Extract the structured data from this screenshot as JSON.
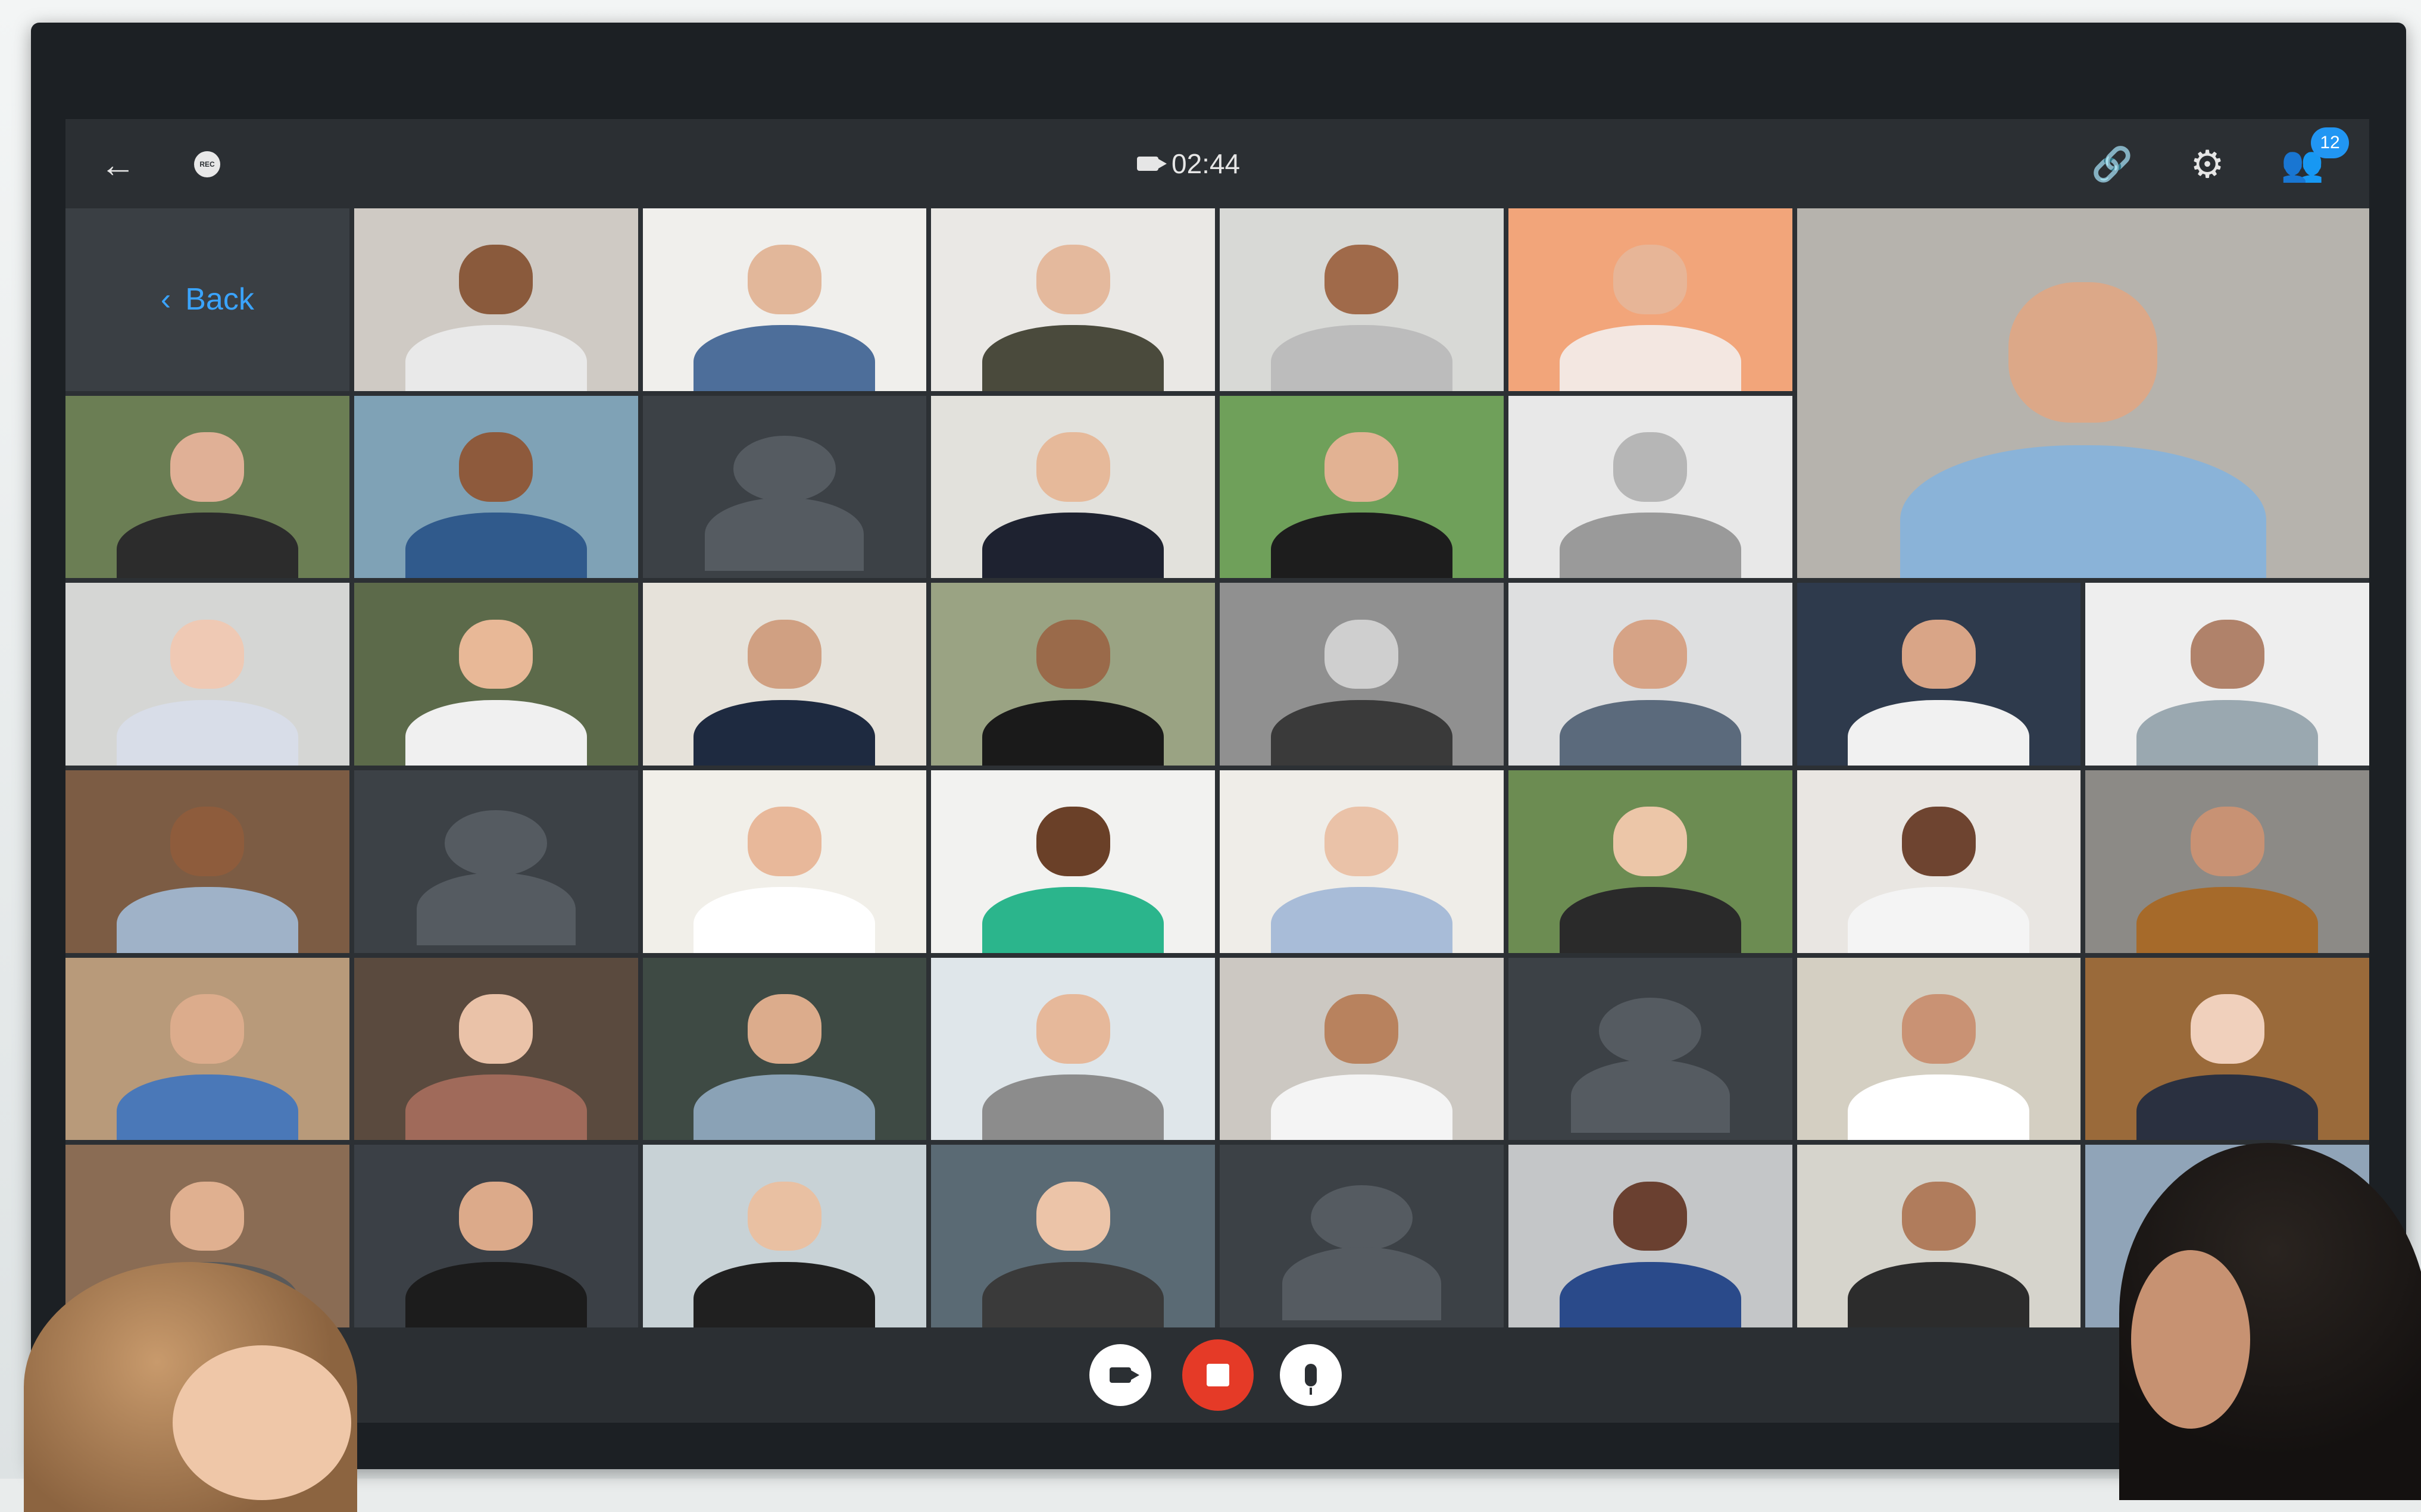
{
  "topbar": {
    "timer": "02:44",
    "rec_label": "REC",
    "participants_count": "12"
  },
  "sidebar": {
    "back_label": "Back"
  },
  "icons": {
    "back": "arrow-left-icon",
    "rec": "rec-icon",
    "timer_camera": "video-camera-icon",
    "link": "link-icon",
    "settings": "gear-icon",
    "participants": "people-icon",
    "video": "video-camera-icon",
    "stop": "stop-icon",
    "mic": "microphone-icon"
  },
  "colors": {
    "accent_blue": "#3aa4ff",
    "badge_blue": "#2196f3",
    "stop_red": "#e53a27",
    "bar_dark": "#2b2f33",
    "empty_tile": "#3c4146"
  },
  "grid": {
    "columns": 8,
    "rows": 6,
    "tiles": [
      {
        "kind": "back"
      },
      {
        "kind": "video",
        "bg": "#cfcac4",
        "skin": "#8a5a3c",
        "cloth": "#e9e9e9"
      },
      {
        "kind": "video",
        "bg": "#f0efec",
        "skin": "#e2b79a",
        "cloth": "#4d6e9a"
      },
      {
        "kind": "video",
        "bg": "#eae8e5",
        "skin": "#e4b99d",
        "cloth": "#4a4a3c"
      },
      {
        "kind": "video",
        "bg": "#d8d9d6",
        "skin": "#a06a4a",
        "cloth": "#bcbcbc"
      },
      {
        "kind": "video",
        "bg": "#f2a57a",
        "skin": "#e7b597",
        "cloth": "#f3e7e1"
      },
      {
        "kind": "featured",
        "bg": "#b6b3ad",
        "skin": "#dca888",
        "cloth": "#8ab3d8"
      },
      {
        "kind": "featured-cont"
      },
      {
        "kind": "video",
        "bg": "#6b7e54",
        "skin": "#e0b096",
        "cloth": "#2c2c2c"
      },
      {
        "kind": "video",
        "bg": "#7fa2b6",
        "skin": "#8e5a3c",
        "cloth": "#305a8c"
      },
      {
        "kind": "empty"
      },
      {
        "kind": "video",
        "bg": "#e2e1dc",
        "skin": "#e6b99a",
        "cloth": "#1e2230"
      },
      {
        "kind": "video",
        "bg": "#6fa05a",
        "skin": "#e2b293",
        "cloth": "#1d1d1d"
      },
      {
        "kind": "video",
        "bg": "#e8e8e8",
        "skin": "#b6b6b6",
        "cloth": "#9a9a9a"
      },
      {
        "kind": "featured-cont"
      },
      {
        "kind": "featured-cont"
      },
      {
        "kind": "video",
        "bg": "#d5d6d4",
        "skin": "#efc9b4",
        "cloth": "#d8dde8"
      },
      {
        "kind": "video",
        "bg": "#5c6a4a",
        "skin": "#e8b897",
        "cloth": "#f0f0f0"
      },
      {
        "kind": "video",
        "bg": "#e6e2da",
        "skin": "#d0a082",
        "cloth": "#1e2a40"
      },
      {
        "kind": "video",
        "bg": "#9aa383",
        "skin": "#9a6a4a",
        "cloth": "#1a1a1a"
      },
      {
        "kind": "video",
        "bg": "#909090",
        "skin": "#cfcfcf",
        "cloth": "#3a3a3a"
      },
      {
        "kind": "video",
        "bg": "#dedfe0",
        "skin": "#d6a386",
        "cloth": "#5b6a7c"
      },
      {
        "kind": "video",
        "bg": "#2e3a4c",
        "skin": "#d9a587",
        "cloth": "#f1f1f1"
      },
      {
        "kind": "video",
        "bg": "#eeeeee",
        "skin": "#b0826a",
        "cloth": "#9aa8b0"
      },
      {
        "kind": "video",
        "bg": "#7c5c44",
        "skin": "#8e5c3c",
        "cloth": "#9fb2c8"
      },
      {
        "kind": "empty"
      },
      {
        "kind": "video",
        "bg": "#f1efe9",
        "skin": "#e8b89a",
        "cloth": "#ffffff"
      },
      {
        "kind": "video",
        "bg": "#f2f2f0",
        "skin": "#6a4028",
        "cloth": "#2bb58c"
      },
      {
        "kind": "video",
        "bg": "#efede8",
        "skin": "#eac2a8",
        "cloth": "#a8bcd8"
      },
      {
        "kind": "video",
        "bg": "#6c8c52",
        "skin": "#ecc6a8",
        "cloth": "#2a2a2a"
      },
      {
        "kind": "video",
        "bg": "#e9e6e2",
        "skin": "#6e4430",
        "cloth": "#f4f4f4"
      },
      {
        "kind": "video",
        "bg": "#8c8a86",
        "skin": "#c89274",
        "cloth": "#a66a2a"
      },
      {
        "kind": "video",
        "bg": "#b89a7a",
        "skin": "#dcac8c",
        "cloth": "#4a78b8"
      },
      {
        "kind": "video",
        "bg": "#5a4a3e",
        "skin": "#eac2a8",
        "cloth": "#a06a5a"
      },
      {
        "kind": "video",
        "bg": "#3e4a44",
        "skin": "#dcac8c",
        "cloth": "#8aa2b6"
      },
      {
        "kind": "video",
        "bg": "#dfe6ea",
        "skin": "#e6b89a",
        "cloth": "#8c8c8c"
      },
      {
        "kind": "video",
        "bg": "#ccc8c2",
        "skin": "#b8825e",
        "cloth": "#f4f4f4"
      },
      {
        "kind": "empty"
      },
      {
        "kind": "video",
        "bg": "#d4cfc2",
        "skin": "#c99274",
        "cloth": "#ffffff"
      },
      {
        "kind": "video",
        "bg": "#9a6a3a",
        "skin": "#f0d0bc",
        "cloth": "#2a3040"
      },
      {
        "kind": "video",
        "bg": "#8a6c54",
        "skin": "#e0b090",
        "cloth": "#5a5a5a"
      },
      {
        "kind": "video",
        "bg": "#3b4046",
        "skin": "#dcaa8a",
        "cloth": "#1c1c1c"
      },
      {
        "kind": "video",
        "bg": "#c8d2d6",
        "skin": "#e9c0a2",
        "cloth": "#202020"
      },
      {
        "kind": "video",
        "bg": "#5a6a74",
        "skin": "#ecc4a8",
        "cloth": "#3a3a3a"
      },
      {
        "kind": "empty"
      },
      {
        "kind": "video",
        "bg": "#c4c6c8",
        "skin": "#6a4030",
        "cloth": "#2a4a8a"
      },
      {
        "kind": "video",
        "bg": "#d6d4cc",
        "skin": "#b07c5c",
        "cloth": "#2c2c2c"
      },
      {
        "kind": "video",
        "bg": "#90a4b8",
        "skin": "#e0b090",
        "cloth": "#303030"
      }
    ]
  }
}
